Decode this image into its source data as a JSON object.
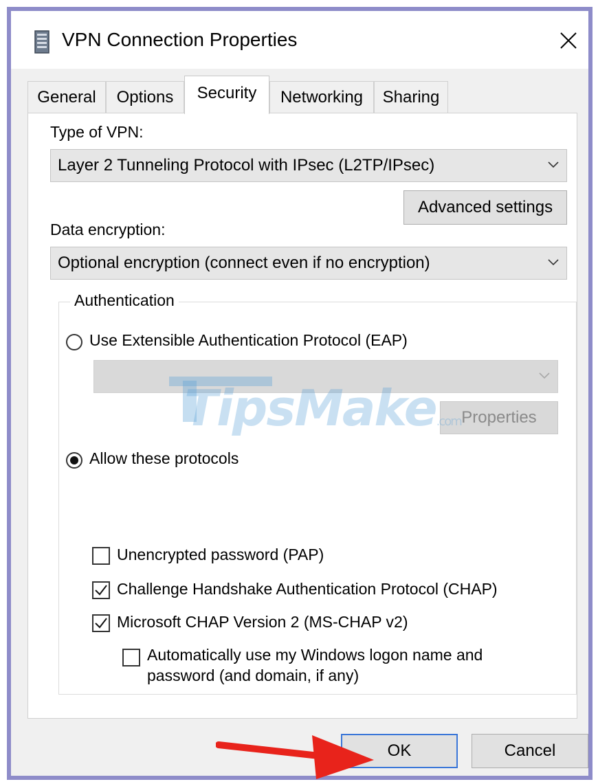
{
  "window": {
    "title": "VPN Connection Properties",
    "close_glyph": "✕",
    "icon": "network-connection-icon"
  },
  "tabs": [
    {
      "label": "General",
      "active": false
    },
    {
      "label": "Options",
      "active": false
    },
    {
      "label": "Security",
      "active": true
    },
    {
      "label": "Networking",
      "active": false
    },
    {
      "label": "Sharing",
      "active": false
    }
  ],
  "security": {
    "vpn_type_label": "Type of VPN:",
    "vpn_type_value": "Layer 2 Tunneling Protocol with IPsec (L2TP/IPsec)",
    "advanced_settings_label": "Advanced settings",
    "encryption_label": "Data encryption:",
    "encryption_value": "Optional encryption (connect even if no encryption)",
    "authentication": {
      "group_label": "Authentication",
      "eap_label": "Use Extensible Authentication Protocol (EAP)",
      "eap_selected": false,
      "eap_value": "",
      "properties_label": "Properties",
      "allow_label": "Allow these protocols",
      "allow_selected": true,
      "protocols": [
        {
          "label": "Unencrypted password (PAP)",
          "checked": false
        },
        {
          "label": "Challenge Handshake Authentication Protocol (CHAP)",
          "checked": true
        },
        {
          "label": "Microsoft CHAP Version 2 (MS-CHAP v2)",
          "checked": true
        }
      ],
      "auto_logon_line1": "Automatically use my Windows logon name and",
      "auto_logon_line2": "password (and domain, if any)",
      "auto_logon_checked": false
    }
  },
  "footer": {
    "ok_label": "OK",
    "cancel_label": "Cancel"
  },
  "watermark": {
    "brand": "TipsMake",
    "suffix": ".com"
  },
  "colors": {
    "dialog_border": "#8e8cc9",
    "focus_blue": "#3a76d8",
    "arrow_red": "#e8231b",
    "watermark_blue": "#5aa0d8"
  }
}
